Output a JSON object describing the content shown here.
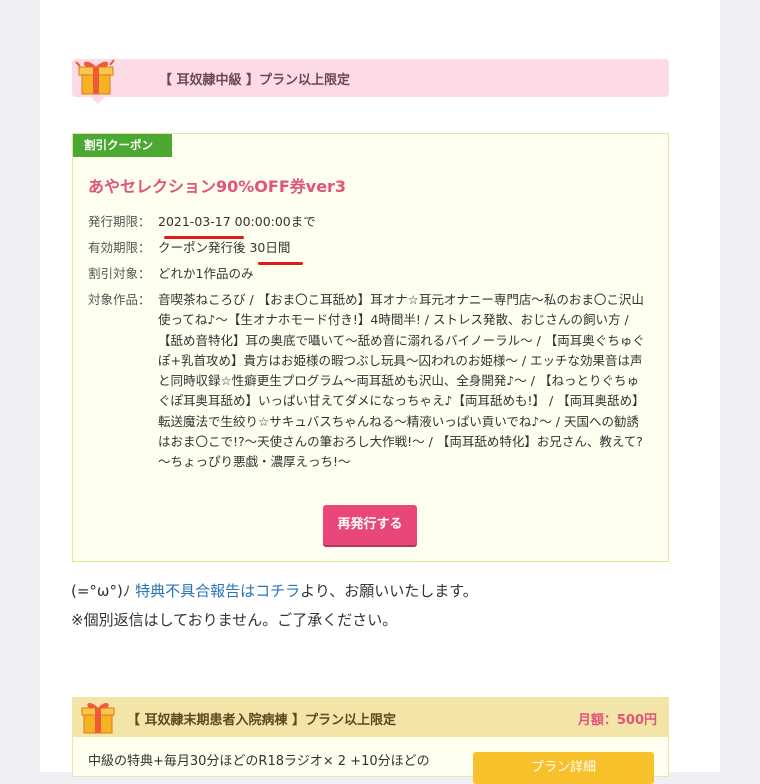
{
  "banner": {
    "text": "【 耳奴隷中級 】プラン以上限定"
  },
  "coupon": {
    "badge": "割引クーポン",
    "title": "あやセレクション90%OFF券ver3",
    "issue_label": "発行期限：",
    "issue_value": "2021-03-17 00:00:00まで",
    "valid_label": "有効期限：",
    "valid_value": "クーポン発行後 30日間",
    "target_label": "割引対象：",
    "target_value": "どれか1作品のみ",
    "works_label": "対象作品：",
    "works_value": "音喫茶ねころび / 【おま〇こ耳舐め】耳オナ☆耳元オナニー専門店～私のおま〇こ沢山使ってね♪～【生オナホモード付き!】4時間半! / ストレス発散、おじさんの飼い方 / 【舐め音特化】耳の奥底で囁いて～舐め音に溺れるバイノーラル～ / 【両耳奥ぐちゅぐぽ+乳首攻め】貴方はお姫様の暇つぶし玩具～囚われのお姫様～ / エッチな効果音は声と同時収録☆性癖更生プログラム～両耳舐めも沢山、全身開発♪～ / 【ねっとりぐちゅぐぽ耳奥耳舐め】いっぱい甘えてダメになっちゃえ♪【両耳舐めも!】 / 【両耳奥舐め】転送魔法で生絞り☆サキュバスちゃんねる～精液いっぱい貢いでね♪～ / 天国への勧誘はおま〇こで!?～天使さんの筆おろし大作戦!～ / 【両耳舐め特化】お兄さん、教えて?～ちょっぴり悪戯・濃厚えっち!～",
    "reissue_label": "再発行する"
  },
  "notes": {
    "line1_prefix": "(=°ω°)ﾉ ",
    "line1_link": "特典不具合報告はコチラ",
    "line1_suffix": "より、お願いいたします。",
    "line2": "※個別返信はしておりません。ご了承ください。"
  },
  "plan2": {
    "title": "【 耳奴隷末期患者入院病棟 】プラン以上限定",
    "price": "月額：500円",
    "body": "中級の特典+毎月30分ほどのR18ラジオ× 2 +10分ほどの",
    "button": "プラン詳細"
  },
  "colors": {
    "accent_pink": "#e94779",
    "badge_green": "#4aa833",
    "link_blue": "#2a74b8",
    "annotation_red": "#e01919"
  }
}
